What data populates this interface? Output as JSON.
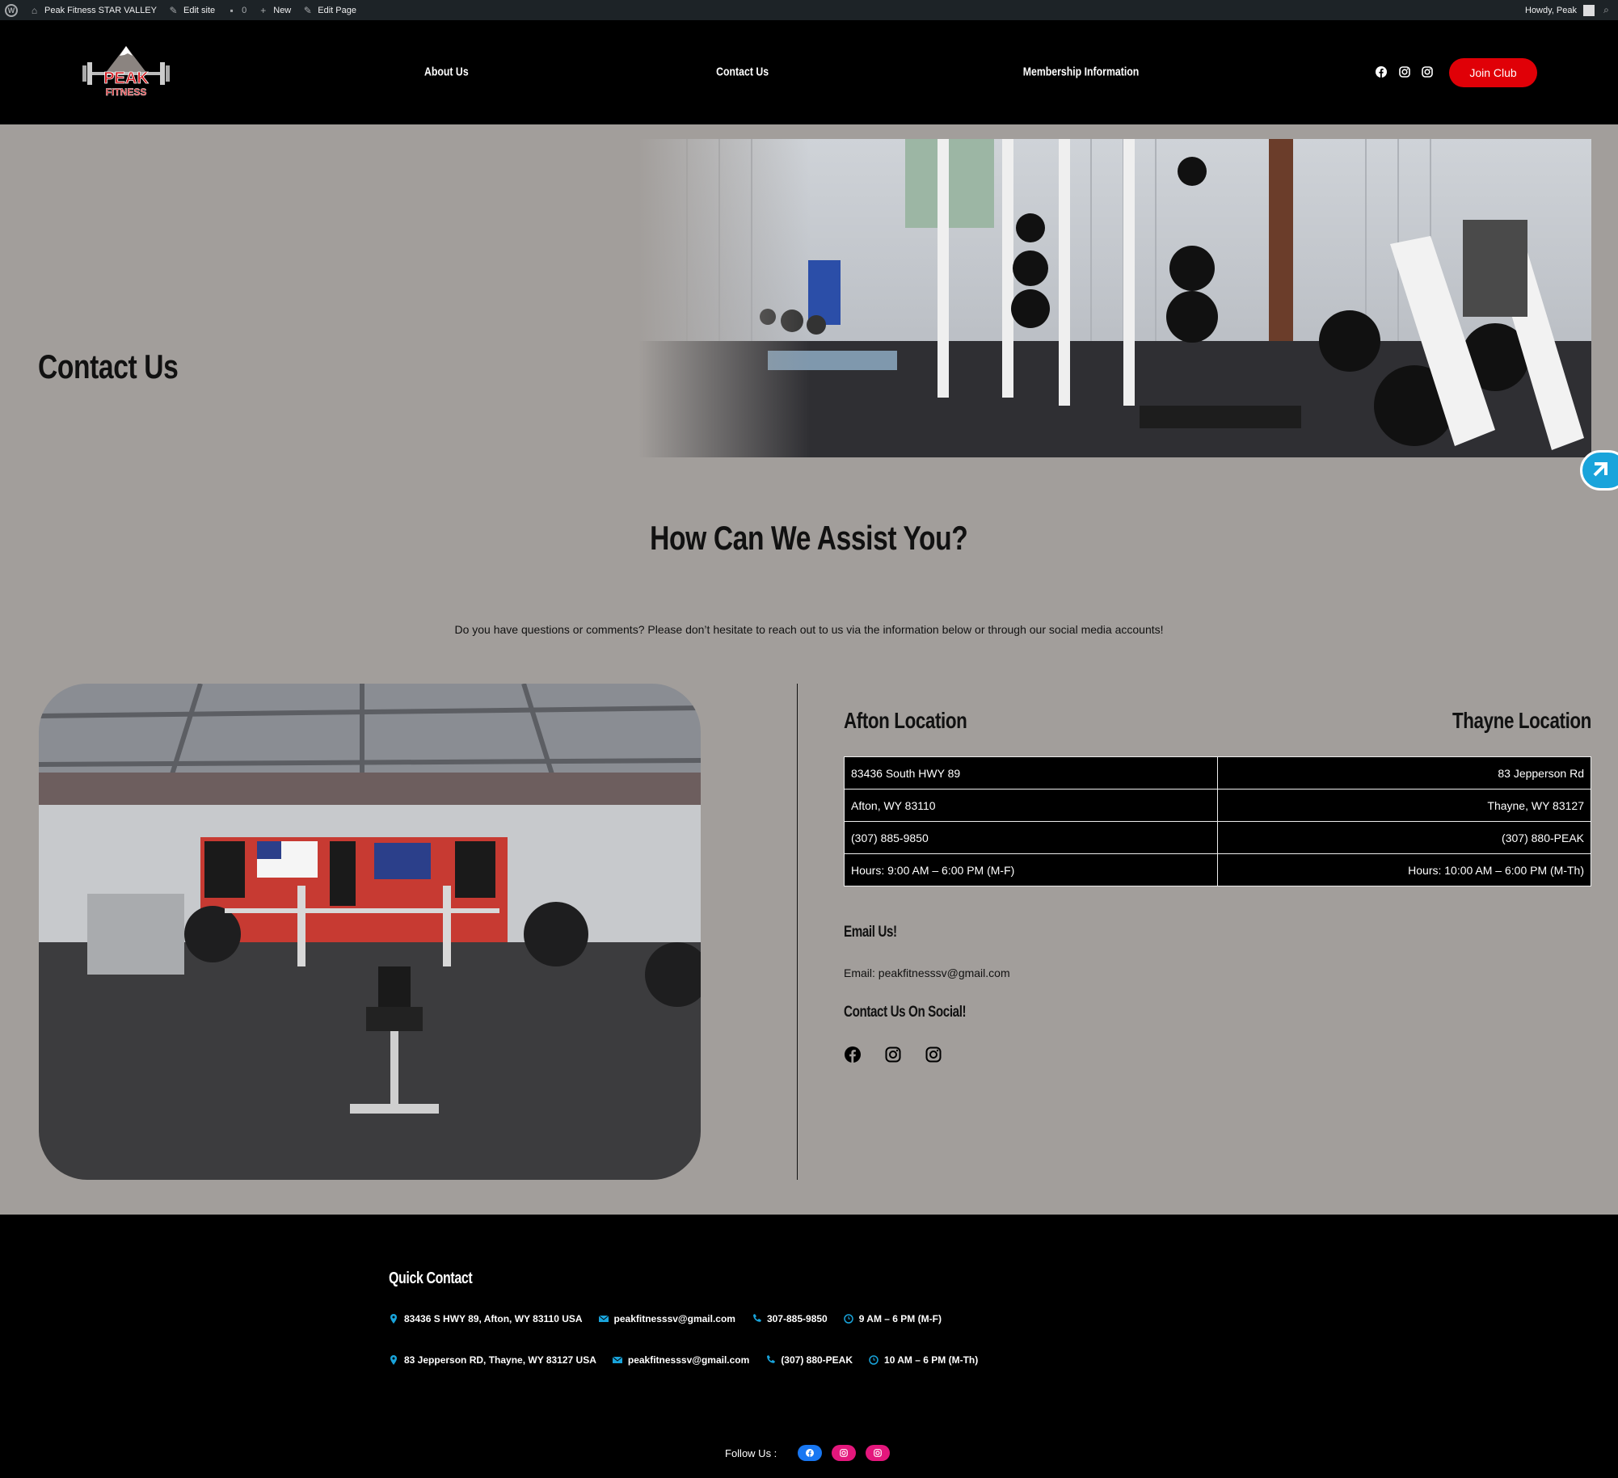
{
  "admin_bar": {
    "site_name": "Peak Fitness STAR VALLEY",
    "edit_site": "Edit site",
    "comments_count": "0",
    "new": "New",
    "edit_page": "Edit Page",
    "howdy": "Howdy, Peak"
  },
  "header": {
    "logo_text_top": "PEAK",
    "logo_text_bottom": "FITNESS",
    "nav": {
      "about": "About Us",
      "contact": "Contact Us",
      "membership": "Membership Information"
    },
    "social_icons": [
      "facebook-icon",
      "instagram-icon",
      "instagram-icon"
    ],
    "join_label": "Join Club"
  },
  "hero": {
    "title": "Contact Us"
  },
  "assist": {
    "title": "How Can We Assist You?",
    "text": "Do you have questions or comments? Please don’t hesitate to reach out to us via the information below or through our social media accounts!"
  },
  "locations": {
    "afton_title": "Afton Location",
    "thayne_title": "Thayne Location",
    "rows": [
      [
        "83436 South HWY 89",
        "83 Jepperson Rd"
      ],
      [
        "Afton, WY 83110",
        "Thayne, WY 83127"
      ],
      [
        "(307) 885-9850",
        "(307) 880-PEAK"
      ],
      [
        "Hours: 9:00 AM – 6:00 PM (M-F)",
        "Hours: 10:00 AM – 6:00 PM (M-Th)"
      ]
    ]
  },
  "email": {
    "title": "Email Us!",
    "line": "Email: peakfitnesssv@gmail.com"
  },
  "social": {
    "title": "Contact Us On Social!"
  },
  "footer": {
    "quick_contact": "Quick Contact",
    "row1": {
      "address": "83436 S HWY 89, Afton, WY 83110 USA",
      "email": "peakfitnesssv@gmail.com",
      "phone": "307-885-9850",
      "hours": "9 AM – 6 PM (M-F)"
    },
    "row2": {
      "address": "83 Jepperson RD, Thayne, WY 83127 USA",
      "email": "peakfitnesssv@gmail.com",
      "phone": "(307) 880-PEAK",
      "hours": "10 AM – 6 PM (M-Th)"
    },
    "follow_us": "Follow Us :"
  },
  "colors": {
    "page_bg": "#a29e9b",
    "header_bg": "#000000",
    "accent_red": "#e00007",
    "facebook_blue": "#1877f2",
    "instagram_pink": "#e4177c",
    "side_tab_blue": "#19a4db"
  }
}
